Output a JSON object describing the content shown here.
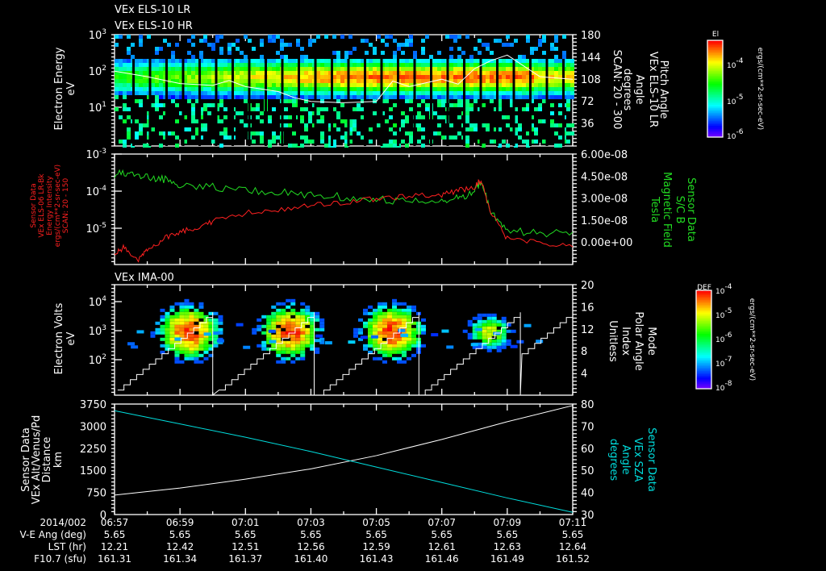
{
  "titles": {
    "p1_line1": "VEx ELS-10 LR",
    "p1_line2": "VEx ELS-10 HR",
    "p3": "VEx IMA-00"
  },
  "colors": {
    "bg": "#000000",
    "axis": "#ffffff",
    "red_series": "#ff2020",
    "green_series": "#22dd22",
    "cyan_series": "#00dddd"
  },
  "labels": {
    "p1_left": [
      "Electron Energy",
      "eV"
    ],
    "p1_right": [
      "Pitch Angle",
      "VEx ELS-10 LR",
      "Angle",
      "degrees",
      "SCAN: 20 - 300"
    ],
    "p2_left": [
      "Sensor Data",
      "VEx ELS-06 LR-Bk",
      "Energy Intensity",
      "ergs/(cm**2-sr-sec-eV)",
      "SCAN: 20 - 150"
    ],
    "p2_right": [
      "Sensor Data",
      "S/C B",
      "Magnetic Field",
      "Tesla"
    ],
    "p3_left": [
      "Electron Volts",
      "eV"
    ],
    "p3_right": [
      "Mode",
      "Polar Angle",
      "Index",
      "Unitless"
    ],
    "p4_left": [
      "Sensor Data",
      "VEx Alt/Venus/Pd",
      "Distance",
      "km"
    ],
    "p4_right": [
      "Sensor Data",
      "VEx SZA",
      "Angle",
      "degrees"
    ]
  },
  "colorbars": [
    {
      "title": "El",
      "units": "ergs/(cm**2-sr-sec-eV)",
      "ticks": [
        {
          "b": "10",
          "e": "-4"
        },
        {
          "b": "10",
          "e": "-5"
        },
        {
          "b": "10",
          "e": "-6"
        }
      ],
      "colormap": "rainbow"
    },
    {
      "title": "DEF",
      "units": "ergs/(cm**2-sr-sec-eV)",
      "ticks": [
        {
          "b": "10",
          "e": "-4"
        },
        {
          "b": "10",
          "e": "-5"
        },
        {
          "b": "10",
          "e": "-6"
        },
        {
          "b": "10",
          "e": "-7"
        },
        {
          "b": "10",
          "e": "-8"
        }
      ],
      "colormap": "rainbow"
    }
  ],
  "time_axis": {
    "date": "2014/002",
    "ticks": [
      "06:57",
      "06:59",
      "07:01",
      "07:03",
      "07:05",
      "07:07",
      "07:09",
      "07:11"
    ],
    "rows": [
      {
        "label": "V-E Ang (deg)",
        "values": [
          "5.65",
          "5.65",
          "5.65",
          "5.65",
          "5.65",
          "5.65",
          "5.65",
          "5.65"
        ]
      },
      {
        "label": "LST (hr)",
        "values": [
          "12.21",
          "12.42",
          "12.51",
          "12.56",
          "12.59",
          "12.61",
          "12.63",
          "12.64"
        ]
      },
      {
        "label": "F10.7 (sfu)",
        "values": [
          "161.31",
          "161.34",
          "161.37",
          "161.40",
          "161.43",
          "161.46",
          "161.49",
          "161.52"
        ]
      }
    ]
  },
  "chart_data": [
    {
      "type": "heatmap",
      "title": "VEx ELS-10 LR",
      "ylabel": "Electron Energy eV",
      "yscale": "log",
      "ylim": [
        1,
        1000
      ],
      "yticks": [
        {
          "b": "10",
          "e": "3"
        },
        {
          "b": "10",
          "e": "2"
        },
        {
          "b": "10",
          "e": "1"
        }
      ],
      "y2label": "Pitch Angle degrees",
      "y2lim": [
        0,
        180
      ],
      "y2ticks": [
        "180",
        "144",
        "108",
        "72",
        "36"
      ],
      "xlim": [
        "06:57",
        "07:11"
      ],
      "peak_energy_eV": 80,
      "overlay_line": {
        "axis": "right",
        "x_min": [
          0,
          1,
          2,
          3,
          3.5,
          4,
          5,
          5.5,
          6,
          7,
          8,
          8.5,
          9,
          10,
          10.5,
          11,
          11.5,
          12,
          13,
          14
        ],
        "y": [
          121,
          112,
          101,
          98,
          106,
          96,
          88,
          78,
          72,
          70,
          72,
          105,
          96,
          108,
          100,
          125,
          138,
          147,
          112,
          108
        ]
      }
    },
    {
      "type": "line",
      "yscale": "log",
      "ylim": [
        1e-06,
        0.001
      ],
      "yticks": [
        {
          "b": "10",
          "e": "-3"
        },
        {
          "b": "10",
          "e": "-4"
        },
        {
          "b": "10",
          "e": "-5"
        }
      ],
      "y2lim": [
        -1.5e-08,
        6e-08
      ],
      "y2ticks": [
        "6.00e-08",
        "4.50e-08",
        "3.00e-08",
        "1.50e-08",
        "0.00e+00"
      ],
      "series": [
        {
          "name": "VEx ELS-06 LR-Bk Energy Intensity",
          "axis": "left",
          "x_min": [
            0,
            0.3,
            0.7,
            1,
            1.5,
            2,
            2.5,
            3,
            4,
            5,
            6,
            7,
            8,
            9,
            10,
            10.5,
            11,
            11.2,
            11.5,
            12,
            13,
            14
          ],
          "y": [
            2e-06,
            3e-06,
            1.2e-06,
            2.5e-06,
            5e-06,
            8e-06,
            1e-05,
            1.5e-05,
            2.5e-05,
            3e-05,
            4e-05,
            5e-05,
            6e-05,
            7e-05,
            8e-05,
            0.0001,
            0.00013,
            0.0002,
            2.5e-05,
            5e-06,
            4e-06,
            3e-06
          ]
        },
        {
          "name": "S/C B Magnetic Field",
          "axis": "right",
          "x_min": [
            0,
            0.5,
            1,
            1.5,
            2,
            3,
            4,
            5,
            6,
            7,
            8,
            9,
            10,
            10.5,
            11,
            11.2,
            11.5,
            12,
            13,
            14
          ],
          "y": [
            4.6e-08,
            4.8e-08,
            4.4e-08,
            4.3e-08,
            3.9e-08,
            3.8e-08,
            3.5e-08,
            3.4e-08,
            3.2e-08,
            3.1e-08,
            2.9e-08,
            2.8e-08,
            2.7e-08,
            3e-08,
            3.5e-08,
            4.2e-08,
            2e-08,
            8e-09,
            6e-09,
            7e-09
          ]
        }
      ]
    },
    {
      "type": "heatmap",
      "title": "VEx IMA-00",
      "ylabel": "Electron Volts eV",
      "yscale": "log",
      "ylim": [
        6,
        40000
      ],
      "yticks": [
        {
          "b": "10",
          "e": "4"
        },
        {
          "b": "10",
          "e": "3"
        },
        {
          "b": "10",
          "e": "2"
        }
      ],
      "y2label": "Mode Polar Angle Index Unitless",
      "y2lim": [
        0,
        20
      ],
      "y2ticks": [
        "20",
        "16",
        "12",
        "8",
        "4"
      ],
      "ion_bursts_min": [
        2.2,
        5.3,
        8.4,
        11.4
      ],
      "overlay_staircase": {
        "axis": "right",
        "reset_min": [
          3.0,
          6.1,
          9.3,
          12.4
        ],
        "max": 15
      }
    },
    {
      "type": "line",
      "ylabel": "Distance km",
      "ylim": [
        0,
        3750
      ],
      "yticks": [
        "3750",
        "3000",
        "2250",
        "1500",
        "750",
        "0"
      ],
      "y2label": "SZA Angle degrees",
      "y2lim": [
        30,
        80
      ],
      "y2ticks": [
        "80",
        "70",
        "60",
        "50",
        "40",
        "30"
      ],
      "series": [
        {
          "name": "VEx Alt/Venus/Pd",
          "axis": "left",
          "x_min": [
            0,
            2,
            4,
            6,
            8,
            10,
            12,
            14
          ],
          "y": [
            660,
            900,
            1200,
            1550,
            2000,
            2550,
            3150,
            3700
          ]
        },
        {
          "name": "VEx SZA",
          "axis": "right",
          "x_min": [
            0,
            2,
            4,
            6,
            8,
            10,
            12,
            14
          ],
          "y": [
            77,
            71,
            65,
            58.5,
            51.5,
            44.5,
            37.5,
            31
          ]
        }
      ]
    }
  ]
}
